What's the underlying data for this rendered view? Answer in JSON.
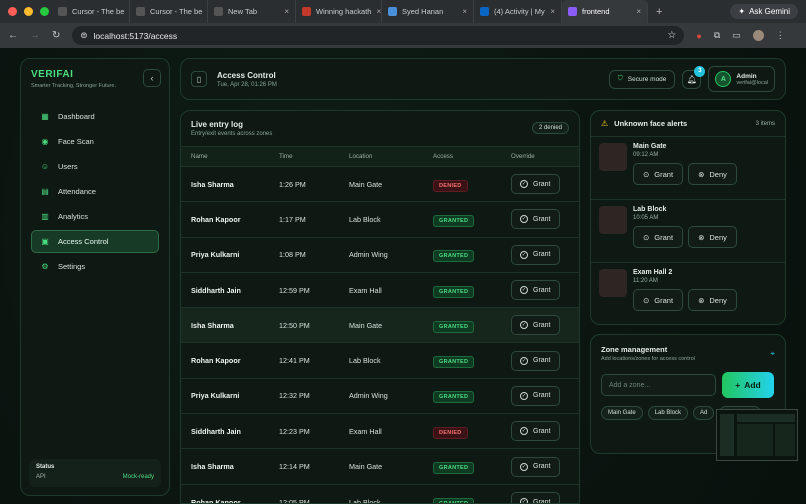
{
  "browser": {
    "tabs": [
      {
        "label": "Cursor - The be",
        "color": "#555"
      },
      {
        "label": "Cursor - The be",
        "color": "#555"
      },
      {
        "label": "New Tab",
        "color": "#555"
      },
      {
        "label": "Winning hackath",
        "color": "#c0392b"
      },
      {
        "label": "Syed Hanan",
        "color": "#4a90d9"
      },
      {
        "label": "(4) Activity | My",
        "color": "#0a66c2"
      },
      {
        "label": "frontend",
        "color": "#8b5cf6"
      }
    ],
    "ask_label": "Ask Gemini",
    "url": "localhost:5173/access"
  },
  "sidebar": {
    "brand": "VERIFAI",
    "tagline": "Smarter Tracking, Stronger Future.",
    "items": [
      {
        "label": "Dashboard",
        "icon": "grid-icon"
      },
      {
        "label": "Face Scan",
        "icon": "camera-icon"
      },
      {
        "label": "Users",
        "icon": "users-icon"
      },
      {
        "label": "Attendance",
        "icon": "calendar-icon"
      },
      {
        "label": "Analytics",
        "icon": "chart-icon"
      },
      {
        "label": "Access Control",
        "icon": "lock-icon"
      },
      {
        "label": "Settings",
        "icon": "gear-icon"
      }
    ],
    "status": {
      "title": "Status",
      "key": "API",
      "value": "Mock-ready"
    }
  },
  "header": {
    "title": "Access Control",
    "date": "Tue, Apr 28, 01:26 PM",
    "secure_label": "Secure mode",
    "notif_count": "3",
    "avatar_letter": "A",
    "user_name": "Admin",
    "user_email": "verifai@local"
  },
  "log": {
    "title": "Live entry log",
    "subtitle": "Entry/exit events across zones",
    "denied_pill": "2 denied",
    "columns": [
      "Name",
      "Time",
      "Location",
      "Access",
      "Override"
    ],
    "grant_label": "Grant",
    "rows": [
      {
        "name": "Isha Sharma",
        "time": "1:26 PM",
        "location": "Main Gate",
        "access": "DENIED"
      },
      {
        "name": "Rohan Kapoor",
        "time": "1:17 PM",
        "location": "Lab Block",
        "access": "GRANTED"
      },
      {
        "name": "Priya Kulkarni",
        "time": "1:08 PM",
        "location": "Admin Wing",
        "access": "GRANTED"
      },
      {
        "name": "Siddharth Jain",
        "time": "12:59 PM",
        "location": "Exam Hall",
        "access": "GRANTED"
      },
      {
        "name": "Isha Sharma",
        "time": "12:50 PM",
        "location": "Main Gate",
        "access": "GRANTED"
      },
      {
        "name": "Rohan Kapoor",
        "time": "12:41 PM",
        "location": "Lab Block",
        "access": "GRANTED"
      },
      {
        "name": "Priya Kulkarni",
        "time": "12:32 PM",
        "location": "Admin Wing",
        "access": "GRANTED"
      },
      {
        "name": "Siddharth Jain",
        "time": "12:23 PM",
        "location": "Exam Hall",
        "access": "DENIED"
      },
      {
        "name": "Isha Sharma",
        "time": "12:14 PM",
        "location": "Main Gate",
        "access": "GRANTED"
      },
      {
        "name": "Rohan Kapoor",
        "time": "12:05 PM",
        "location": "Lab Block",
        "access": "GRANTED"
      }
    ]
  },
  "alerts": {
    "title": "Unknown face alerts",
    "count": "3 items",
    "grant_label": "Grant",
    "deny_label": "Deny",
    "items": [
      {
        "location": "Main Gate",
        "time": "09:12 AM"
      },
      {
        "location": "Lab Block",
        "time": "10:05 AM"
      },
      {
        "location": "Exam Hall 2",
        "time": "11:20 AM"
      }
    ]
  },
  "zones": {
    "title": "Zone management",
    "subtitle": "Add locations/zones for access control",
    "placeholder": "Add a zone...",
    "add_label": "Add",
    "chips": [
      "Main Gate",
      "Lab Block",
      "Ad",
      "Exam Hall"
    ]
  },
  "colors": {
    "accent": "#4ade80",
    "denied": "#f87171",
    "cyan": "#22c1dc"
  }
}
